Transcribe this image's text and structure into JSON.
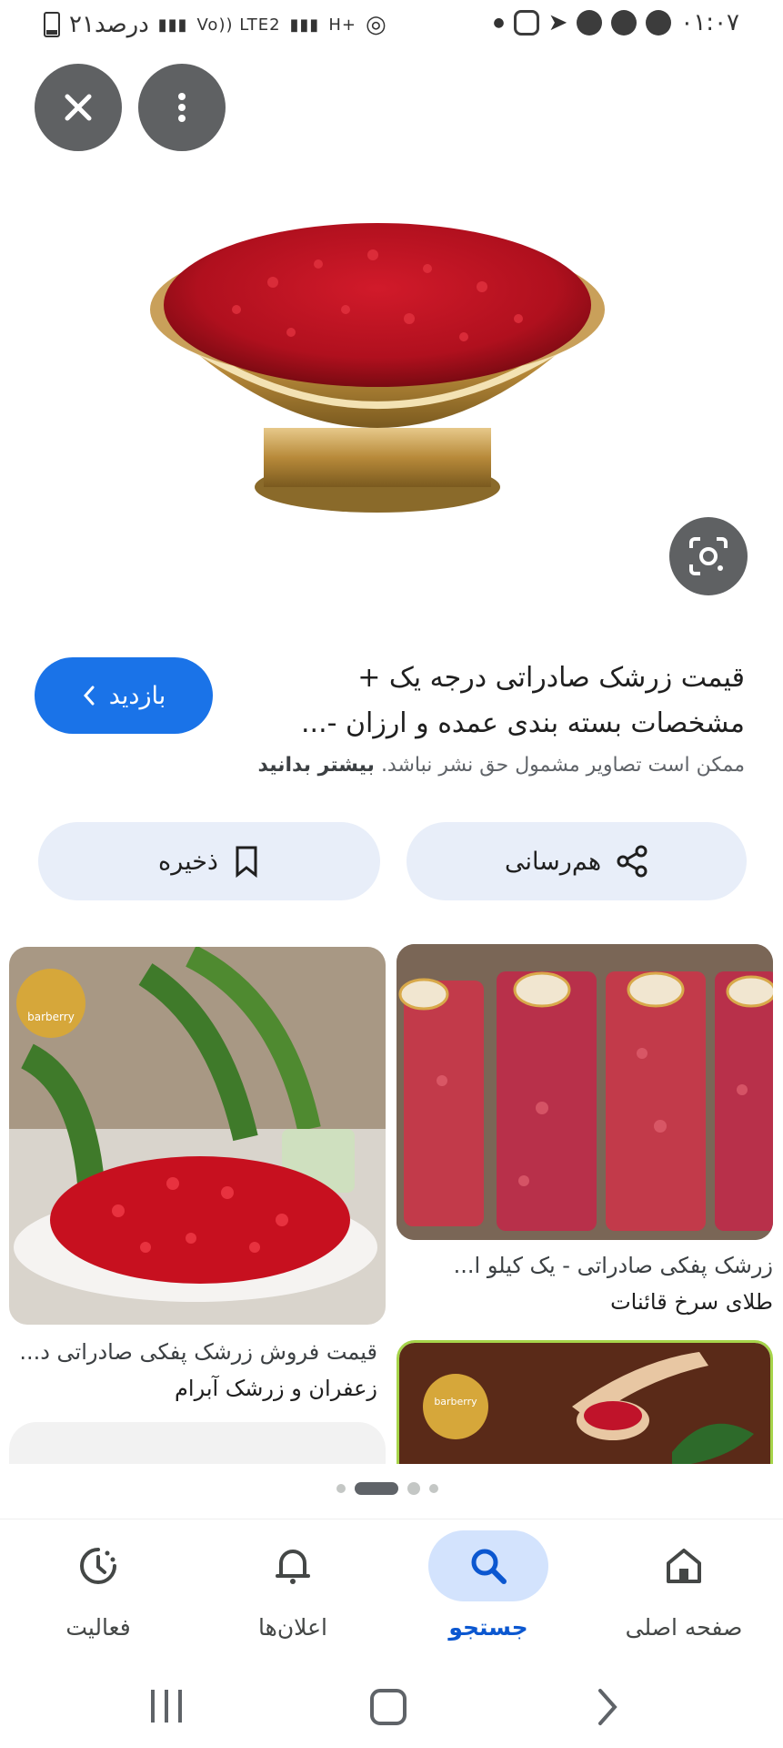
{
  "status_bar": {
    "time": "۰۱:۰۷",
    "battery_text": "۲۱درصد",
    "network_labels": [
      "Vo)) LTE2",
      "H+"
    ]
  },
  "top_buttons": {
    "close_icon": "close-icon",
    "more_icon": "more-vertical-icon"
  },
  "result": {
    "title_line1": "قیمت زرشک صادراتی درجه یک +",
    "title_line2": "مشخصات بسته بندی عمده و ارزان -...",
    "visit_label": "بازدید",
    "copyright_text": "ممکن است تصاویر مشمول حق نشر نباشد.",
    "learn_more": "بیشتر بدانید"
  },
  "actions": {
    "share_label": "هم‌رسانی",
    "save_label": "ذخیره"
  },
  "related": [
    {
      "title": "زرشک پفکی صادراتی - یک کیلو ا...",
      "site": "طلای سرخ قائنات"
    },
    {
      "title": "قیمت فروش زرشک پفکی صادراتی د...",
      "site": "زعفران و زرشک آبرام"
    }
  ],
  "logo_text": "barberry",
  "bottom_nav": [
    {
      "label": "صفحه اصلی",
      "icon": "home-icon"
    },
    {
      "label": "جستجو",
      "icon": "search-icon",
      "active": true
    },
    {
      "label": "اعلان‌ها",
      "icon": "bell-icon"
    },
    {
      "label": "فعالیت",
      "icon": "activity-icon"
    }
  ],
  "colors": {
    "accent": "#1a73e8",
    "pill_bg": "#e8eef9",
    "nav_active_bg": "#d3e3fd"
  }
}
